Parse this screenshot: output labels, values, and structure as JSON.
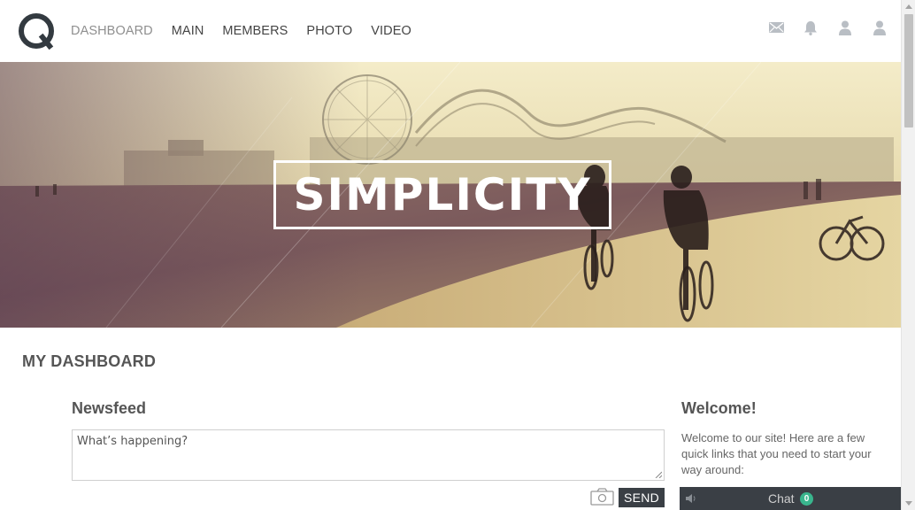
{
  "nav": {
    "items": [
      {
        "label": "DASHBOARD",
        "active": true
      },
      {
        "label": "MAIN"
      },
      {
        "label": "MEMBERS"
      },
      {
        "label": "PHOTO"
      },
      {
        "label": "VIDEO"
      }
    ]
  },
  "header_icons": [
    "mail-icon",
    "bell-icon",
    "user-icon",
    "profile-icon"
  ],
  "hero": {
    "title": "SIMPLICITY"
  },
  "dashboard": {
    "title": "MY DASHBOARD"
  },
  "newsfeed": {
    "title": "Newsfeed",
    "status_placeholder": "What’s happening?",
    "send_label": "SEND"
  },
  "welcome": {
    "title": "Welcome!",
    "text": "Welcome to our site! Here are a few quick links that you need to start your way around:"
  },
  "chat": {
    "label": "Chat",
    "count": "0"
  },
  "colors": {
    "dark_button": "#3a3f45",
    "chat_badge": "#39b58d",
    "nav_active": "#8f8f8f"
  }
}
